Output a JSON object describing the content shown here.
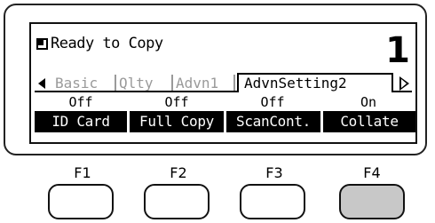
{
  "status": {
    "icon": "copy-status-icon",
    "text": "Ready to Copy",
    "copy_count": "1"
  },
  "tabs": [
    {
      "label": "Basic",
      "active": false
    },
    {
      "label": "Qlty",
      "active": false
    },
    {
      "label": "Advn1",
      "active": false
    },
    {
      "label": "AdvnSetting2",
      "active": true
    }
  ],
  "values": [
    "Off",
    "Off",
    "Off",
    "On"
  ],
  "softkeys": [
    "ID Card",
    "Full Copy",
    "ScanCont.",
    "Collate"
  ],
  "function_keys": [
    {
      "label": "F1",
      "highlighted": false
    },
    {
      "label": "F2",
      "highlighted": false
    },
    {
      "label": "F3",
      "highlighted": false
    },
    {
      "label": "F4",
      "highlighted": true
    }
  ]
}
